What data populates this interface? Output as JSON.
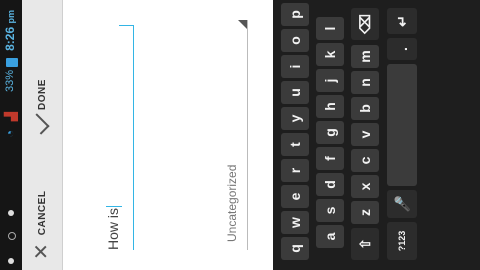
{
  "status_bar": {
    "time": "8:26",
    "time_suffix": "pm",
    "battery": "33%"
  },
  "action_bar": {
    "cancel_label": "CANCEL",
    "done_label": "DONE"
  },
  "editor": {
    "body_value": "How is",
    "category": "Uncategorized"
  },
  "keyboard": {
    "rows": [
      [
        "q",
        "w",
        "e",
        "r",
        "t",
        "y",
        "u",
        "i",
        "o",
        "p"
      ],
      [
        "a",
        "s",
        "d",
        "f",
        "g",
        "h",
        "j",
        "k",
        "l"
      ],
      [
        "z",
        "x",
        "c",
        "v",
        "b",
        "n",
        "m"
      ]
    ],
    "symbols_label": "?123",
    "period_label": "."
  }
}
